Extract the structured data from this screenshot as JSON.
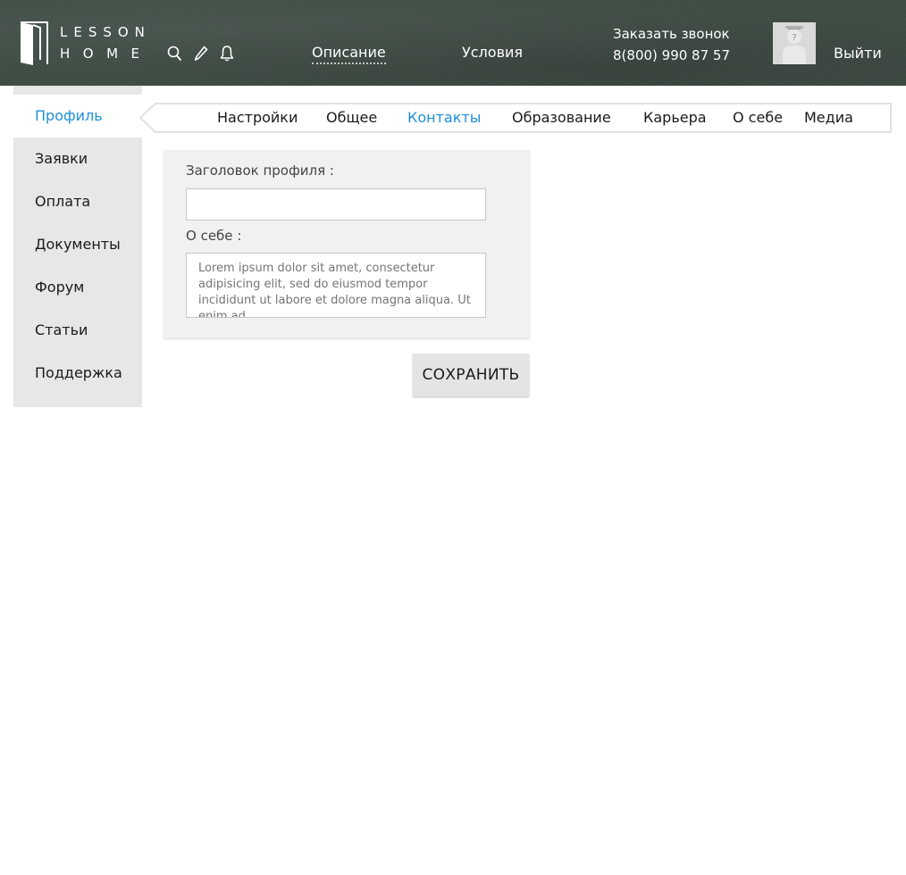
{
  "brand": {
    "line1": "LESSON",
    "line2": "HOME"
  },
  "header": {
    "icons": [
      "search-icon",
      "pencil-icon",
      "bell-icon"
    ],
    "nav": [
      {
        "label": "Описание",
        "active": true
      },
      {
        "label": "Условия",
        "active": false
      }
    ],
    "callback": {
      "label": "Заказать звонок",
      "phone": "8(800) 990 87 57"
    },
    "avatar_placeholder": "?",
    "logout_label": "Выйти"
  },
  "sidebar": {
    "items": [
      {
        "label": "Профиль",
        "active": true
      },
      {
        "label": "Заявки"
      },
      {
        "label": "Оплата"
      },
      {
        "label": "Документы"
      },
      {
        "label": "Форум"
      },
      {
        "label": "Статьи"
      },
      {
        "label": "Поддержка"
      }
    ]
  },
  "tabs": {
    "items": [
      {
        "label": "Настройки"
      },
      {
        "label": "Общее"
      },
      {
        "label": "Контакты",
        "active": true
      },
      {
        "label": "Образование"
      },
      {
        "label": "Карьера"
      },
      {
        "label": "О себе"
      },
      {
        "label": "Медиа"
      }
    ]
  },
  "form": {
    "title_label": "Заголовок профиля :",
    "title_value": "",
    "about_label": "О себе :",
    "about_placeholder": "Lorem ipsum dolor sit amet, consectetur adipisicing elit, sed do eiusmod tempor incididunt ut labore et dolore magna aliqua. Ut enim ad"
  },
  "save_label": "СОХРАНИТЬ",
  "colors": {
    "header_bg": "#3f4c44",
    "accent": "#1e90d8",
    "sidebar_bg": "#e7e7e7"
  }
}
